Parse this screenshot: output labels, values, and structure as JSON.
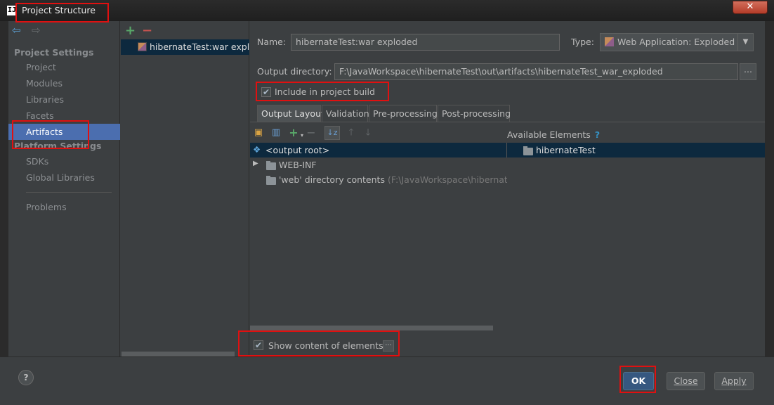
{
  "window": {
    "app_icon_glyph": "IJ",
    "title": "Project Structure",
    "close_glyph": "✕"
  },
  "sidebar": {
    "back_glyph": "⇦",
    "forward_glyph": "⇨",
    "project_settings_header": "Project Settings",
    "project_settings_items": [
      {
        "label": "Project",
        "selected": false
      },
      {
        "label": "Modules",
        "selected": false
      },
      {
        "label": "Libraries",
        "selected": false
      },
      {
        "label": "Facets",
        "selected": false
      },
      {
        "label": "Artifacts",
        "selected": true
      }
    ],
    "platform_settings_header": "Platform Settings",
    "platform_settings_items": [
      {
        "label": "SDKs"
      },
      {
        "label": "Global Libraries"
      }
    ],
    "problems_label": "Problems"
  },
  "artifacts": {
    "add_glyph": "+",
    "remove_glyph": "−",
    "items": [
      {
        "label": "hibernateTest:war exploded",
        "selected": true
      }
    ]
  },
  "form": {
    "name_label": "Name:",
    "name_value": "hibernateTest:war exploded",
    "type_label": "Type:",
    "type_value": "Web Application: Exploded",
    "type_arrow_glyph": "▼",
    "output_dir_label": "Output directory:",
    "output_dir_value": "F:\\JavaWorkspace\\hibernateTest\\out\\artifacts\\hibernateTest_war_exploded",
    "browse_label": "...",
    "include_build_label": "Include in project build",
    "include_build_checked": true
  },
  "tabs": [
    {
      "label": "Output Layout",
      "active": true
    },
    {
      "label": "Validation",
      "active": false
    },
    {
      "label": "Pre-processing",
      "active": false
    },
    {
      "label": "Post-processing",
      "active": false
    }
  ],
  "layout": {
    "available_elements_label": "Available Elements",
    "help_glyph": "?",
    "tree": [
      {
        "label": "<output root>",
        "selected": true
      },
      {
        "label": "WEB-INF",
        "expand_glyph": "▶"
      },
      {
        "label": "'web' directory contents",
        "detail": "(F:\\JavaWorkspace\\hibernateTe"
      }
    ],
    "available_tree": [
      {
        "label": "hibernateTest"
      }
    ],
    "show_content_label": "Show content of elements",
    "show_content_checked": true,
    "show_content_more": "..."
  },
  "footer": {
    "help_glyph": "?",
    "ok_label": "OK",
    "close_label": "Close",
    "apply_label": "Apply"
  },
  "highlight_color": "#e01010",
  "selection_color": "#4b6eaf"
}
